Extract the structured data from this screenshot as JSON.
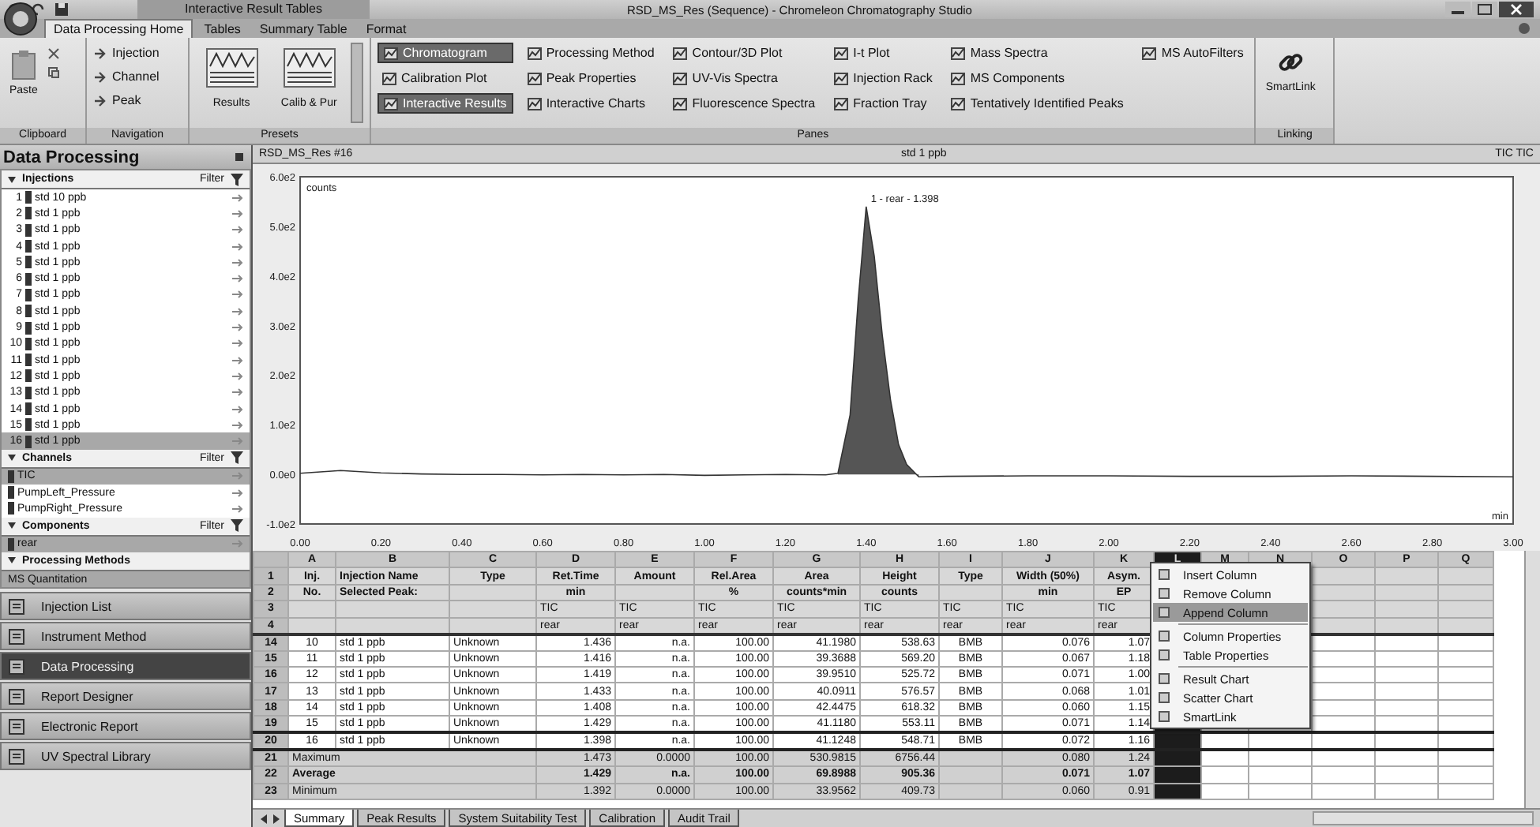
{
  "window": {
    "contextual_tab": "Interactive Result Tables",
    "title": "RSD_MS_Res (Sequence) - Chromeleon Chromatography Studio"
  },
  "ribbon_tabs": [
    {
      "label": "Data Processing Home",
      "selected": true
    },
    {
      "label": "Tables",
      "selected": false
    },
    {
      "label": "Summary Table",
      "selected": false
    },
    {
      "label": "Format",
      "selected": false
    }
  ],
  "ribbon": {
    "clipboard": {
      "label": "Clipboard",
      "paste": "Paste"
    },
    "navigation": {
      "label": "Navigation",
      "items": [
        "Injection",
        "Channel",
        "Peak"
      ]
    },
    "presets": {
      "label": "Presets",
      "items": [
        "Results",
        "Calib & Pur"
      ]
    },
    "panes": {
      "label": "Panes",
      "columns": [
        [
          {
            "label": "Chromatogram",
            "selected": true
          },
          {
            "label": "Calibration Plot",
            "selected": false
          },
          {
            "label": "Interactive Results",
            "selected": true
          }
        ],
        [
          {
            "label": "Processing Method",
            "selected": false
          },
          {
            "label": "Peak Properties",
            "selected": false
          },
          {
            "label": "Interactive Charts",
            "selected": false
          }
        ],
        [
          {
            "label": "Contour/3D Plot",
            "selected": false
          },
          {
            "label": "UV-Vis Spectra",
            "selected": false
          },
          {
            "label": "Fluorescence Spectra",
            "selected": false
          }
        ],
        [
          {
            "label": "I-t Plot",
            "selected": false
          },
          {
            "label": "Injection Rack",
            "selected": false
          },
          {
            "label": "Fraction Tray",
            "selected": false
          }
        ],
        [
          {
            "label": "Mass Spectra",
            "selected": false
          },
          {
            "label": "MS Components",
            "selected": false
          },
          {
            "label": "Tentatively Identified Peaks",
            "selected": false
          }
        ],
        [
          {
            "label": "MS AutoFilters",
            "selected": false
          }
        ]
      ]
    },
    "linking": {
      "label": "Linking",
      "button": "SmartLink"
    }
  },
  "data_processing": {
    "title": "Data Processing",
    "injections": {
      "title": "Injections",
      "filter": "Filter",
      "items": [
        {
          "num": "1",
          "name": "std 10 ppb",
          "selected": false
        },
        {
          "num": "2",
          "name": "std 1 ppb",
          "selected": false
        },
        {
          "num": "3",
          "name": "std 1 ppb",
          "selected": false
        },
        {
          "num": "4",
          "name": "std 1 ppb",
          "selected": false
        },
        {
          "num": "5",
          "name": "std 1 ppb",
          "selected": false
        },
        {
          "num": "6",
          "name": "std 1 ppb",
          "selected": false
        },
        {
          "num": "7",
          "name": "std 1 ppb",
          "selected": false
        },
        {
          "num": "8",
          "name": "std 1 ppb",
          "selected": false
        },
        {
          "num": "9",
          "name": "std 1 ppb",
          "selected": false
        },
        {
          "num": "10",
          "name": "std 1 ppb",
          "selected": false
        },
        {
          "num": "11",
          "name": "std 1 ppb",
          "selected": false
        },
        {
          "num": "12",
          "name": "std 1 ppb",
          "selected": false
        },
        {
          "num": "13",
          "name": "std 1 ppb",
          "selected": false
        },
        {
          "num": "14",
          "name": "std 1 ppb",
          "selected": false
        },
        {
          "num": "15",
          "name": "std 1 ppb",
          "selected": false
        },
        {
          "num": "16",
          "name": "std 1 ppb",
          "selected": true
        }
      ]
    },
    "channels": {
      "title": "Channels",
      "filter": "Filter",
      "items": [
        {
          "name": "TIC",
          "selected": true
        },
        {
          "name": "PumpLeft_Pressure",
          "selected": false
        },
        {
          "name": "PumpRight_Pressure",
          "selected": false
        }
      ]
    },
    "components": {
      "title": "Components",
      "filter": "Filter",
      "items": [
        {
          "name": "rear",
          "selected": true
        }
      ]
    },
    "processing_methods": {
      "title": "Processing Methods",
      "items": [
        {
          "name": "MS Quantitation",
          "selected": true
        }
      ]
    }
  },
  "nav_buttons": [
    {
      "label": "Injection List",
      "selected": false
    },
    {
      "label": "Instrument Method",
      "selected": false
    },
    {
      "label": "Data Processing",
      "selected": true
    },
    {
      "label": "Report Designer",
      "selected": false
    },
    {
      "label": "Electronic Report",
      "selected": false
    },
    {
      "label": "UV Spectral Library",
      "selected": false
    }
  ],
  "chart": {
    "header_left": "RSD_MS_Res #16",
    "header_center": "std 1 ppb",
    "header_right": "TIC TIC",
    "peak_label": "1 - rear - 1.398",
    "chart_data": {
      "type": "line",
      "xlabel": "min",
      "ylabel": "counts",
      "xlim": [
        0,
        3
      ],
      "ylim": [
        -100,
        600
      ],
      "x": [
        0,
        0.1,
        0.2,
        0.3,
        0.4,
        0.5,
        0.6,
        0.7,
        0.8,
        0.9,
        1.0,
        1.1,
        1.2,
        1.3,
        1.33,
        1.36,
        1.38,
        1.4,
        1.42,
        1.44,
        1.46,
        1.48,
        1.5,
        1.53,
        1.6,
        1.8,
        2.0,
        2.2,
        2.4,
        2.6,
        2.8,
        3.0
      ],
      "series": [
        {
          "color": "#333333",
          "values": [
            2,
            8,
            3,
            1,
            0,
            0,
            -1,
            0,
            -1,
            0,
            -2,
            -1,
            0,
            -1,
            2,
            120,
            350,
            540,
            440,
            280,
            150,
            60,
            20,
            -5,
            -4,
            -3,
            -3,
            -4,
            -4,
            -3,
            -4,
            -5
          ]
        }
      ],
      "yticks": [
        {
          "value": 600,
          "label": "6.0e2"
        },
        {
          "value": 500,
          "label": "5.0e2"
        },
        {
          "value": 400,
          "label": "4.0e2"
        },
        {
          "value": 300,
          "label": "3.0e2"
        },
        {
          "value": 200,
          "label": "2.0e2"
        },
        {
          "value": 100,
          "label": "1.0e2"
        },
        {
          "value": 0,
          "label": "0.0e0"
        },
        {
          "value": -100,
          "label": "-1.0e2"
        }
      ],
      "xticks": [
        {
          "value": 0,
          "label": "0.00"
        },
        {
          "value": 0.2,
          "label": "0.20"
        },
        {
          "value": 0.4,
          "label": "0.40"
        },
        {
          "value": 0.6,
          "label": "0.60"
        },
        {
          "value": 0.8,
          "label": "0.80"
        },
        {
          "value": 1.0,
          "label": "1.00"
        },
        {
          "value": 1.2,
          "label": "1.20"
        },
        {
          "value": 1.4,
          "label": "1.40"
        },
        {
          "value": 1.6,
          "label": "1.60"
        },
        {
          "value": 1.8,
          "label": "1.80"
        },
        {
          "value": 2.0,
          "label": "2.00"
        },
        {
          "value": 2.2,
          "label": "2.20"
        },
        {
          "value": 2.4,
          "label": "2.40"
        },
        {
          "value": 2.6,
          "label": "2.60"
        },
        {
          "value": 2.8,
          "label": "2.80"
        },
        {
          "value": 3.0,
          "label": "3.00"
        }
      ]
    }
  },
  "table": {
    "columns": [
      {
        "letter": "A",
        "h1": "Inj.",
        "h2": "No.",
        "selected": false
      },
      {
        "letter": "B",
        "h1": "Injection Name",
        "h2": "Selected Peak:",
        "selected": false
      },
      {
        "letter": "C",
        "h1": "Type",
        "selected": false
      },
      {
        "letter": "D",
        "h1": "Ret.Time",
        "h2": "min",
        "h3": "TIC",
        "h4": "rear",
        "selected": false
      },
      {
        "letter": "E",
        "h1": "Amount",
        "h3": "TIC",
        "h4": "rear",
        "selected": false
      },
      {
        "letter": "F",
        "h1": "Rel.Area",
        "h2": "%",
        "h3": "TIC",
        "h4": "rear",
        "selected": false
      },
      {
        "letter": "G",
        "h1": "Area",
        "h2": "counts*min",
        "h3": "TIC",
        "h4": "rear",
        "selected": false
      },
      {
        "letter": "H",
        "h1": "Height",
        "h2": "counts",
        "h3": "TIC",
        "h4": "rear",
        "selected": false
      },
      {
        "letter": "I",
        "h1": "Type",
        "h3": "TIC",
        "h4": "rear",
        "selected": false
      },
      {
        "letter": "J",
        "h1": "Width (50%)",
        "h2": "min",
        "h3": "TIC",
        "h4": "rear",
        "selected": false
      },
      {
        "letter": "K",
        "h1": "Asym.",
        "h2": "EP",
        "h3": "TIC",
        "h4": "rear",
        "selected": false
      },
      {
        "letter": "L",
        "selected": true
      },
      {
        "letter": "M",
        "selected": false
      },
      {
        "letter": "N",
        "selected": false
      },
      {
        "letter": "O",
        "selected": false
      },
      {
        "letter": "P",
        "selected": false
      },
      {
        "letter": "Q",
        "selected": false
      }
    ],
    "header_rows": [
      "1",
      "2",
      "3",
      "4"
    ],
    "rows": [
      {
        "row": "14",
        "selected": false,
        "cells": [
          "10",
          "std 1 ppb",
          "Unknown",
          "1.436",
          "n.a.",
          "100.00",
          "41.1980",
          "538.63",
          "BMB",
          "0.076",
          "1.07"
        ]
      },
      {
        "row": "15",
        "selected": false,
        "cells": [
          "11",
          "std 1 ppb",
          "Unknown",
          "1.416",
          "n.a.",
          "100.00",
          "39.3688",
          "569.20",
          "BMB",
          "0.067",
          "1.18"
        ]
      },
      {
        "row": "16",
        "selected": false,
        "cells": [
          "12",
          "std 1 ppb",
          "Unknown",
          "1.419",
          "n.a.",
          "100.00",
          "39.9510",
          "525.72",
          "BMB",
          "0.071",
          "1.00"
        ]
      },
      {
        "row": "17",
        "selected": false,
        "cells": [
          "13",
          "std 1 ppb",
          "Unknown",
          "1.433",
          "n.a.",
          "100.00",
          "40.0911",
          "576.57",
          "BMB",
          "0.068",
          "1.01"
        ]
      },
      {
        "row": "18",
        "selected": false,
        "cells": [
          "14",
          "std 1 ppb",
          "Unknown",
          "1.408",
          "n.a.",
          "100.00",
          "42.4475",
          "618.32",
          "BMB",
          "0.060",
          "1.15"
        ]
      },
      {
        "row": "19",
        "selected": false,
        "cells": [
          "15",
          "std 1 ppb",
          "Unknown",
          "1.429",
          "n.a.",
          "100.00",
          "41.1180",
          "553.11",
          "BMB",
          "0.071",
          "1.14"
        ]
      },
      {
        "row": "20",
        "selected": true,
        "cells": [
          "16",
          "std 1 ppb",
          "Unknown",
          "1.398",
          "n.a.",
          "100.00",
          "41.1248",
          "548.71",
          "BMB",
          "0.072",
          "1.16"
        ]
      }
    ],
    "summary_rows": [
      {
        "row": "21",
        "label": "Maximum",
        "bold": false,
        "values": [
          "1.473",
          "0.0000",
          "100.00",
          "530.9815",
          "6756.44",
          "0.080",
          "1.24"
        ]
      },
      {
        "row": "22",
        "label": "Average",
        "bold": true,
        "values": [
          "1.429",
          "n.a.",
          "100.00",
          "69.8988",
          "905.36",
          "0.071",
          "1.07"
        ]
      },
      {
        "row": "23",
        "label": "Minimum",
        "bold": false,
        "values": [
          "1.392",
          "0.0000",
          "100.00",
          "33.9562",
          "409.73",
          "0.060",
          "0.91"
        ]
      }
    ]
  },
  "context_menu": [
    {
      "label": "Insert Column",
      "selected": false
    },
    {
      "label": "Remove Column",
      "selected": false
    },
    {
      "label": "Append Column",
      "selected": true
    },
    {
      "label": "Column Properties",
      "selected": false
    },
    {
      "label": "Table Properties",
      "selected": false
    },
    {
      "label": "Result Chart",
      "selected": false
    },
    {
      "label": "Scatter Chart",
      "selected": false
    },
    {
      "label": "SmartLink",
      "selected": false
    }
  ],
  "sheet_tabs": [
    {
      "label": "Summary",
      "selected": true
    },
    {
      "label": "Peak Results",
      "selected": false
    },
    {
      "label": "System Suitability Test",
      "selected": false
    },
    {
      "label": "Calibration",
      "selected": false
    },
    {
      "label": "Audit Trail",
      "selected": false
    }
  ]
}
